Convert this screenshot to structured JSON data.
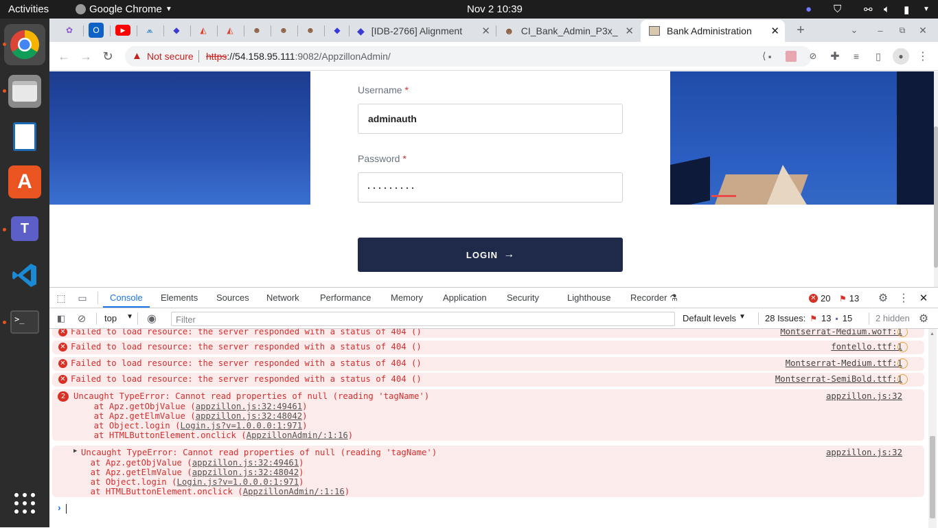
{
  "system": {
    "activities": "Activities",
    "app_menu": "Google Chrome",
    "clock": "Nov 2  10:39"
  },
  "tabs": {
    "tab1_title": "[IDB-2766] Alignment",
    "tab2_title": "CI_Bank_Admin_P3x_",
    "active_title": "Bank Administration"
  },
  "address": {
    "security": "Not secure",
    "scheme": "https",
    "host_url": "://54.158.95.111",
    "port_path": ":9082/AppzillonAdmin/"
  },
  "login": {
    "username_label": "Username",
    "username_value": "adminauth",
    "password_label": "Password",
    "password_value": "·········",
    "required_mark": "*",
    "button": "LOGIN"
  },
  "devtools": {
    "tabs": [
      "Console",
      "Elements",
      "Sources",
      "Network",
      "Performance",
      "Memory",
      "Application",
      "Security",
      "Lighthouse",
      "Recorder"
    ],
    "error_count": "20",
    "issue_flag_count": "13",
    "context": "top",
    "filter_placeholder": "Filter",
    "levels": "Default levels",
    "issues_label": "28 Issues:",
    "issues_errors": "13",
    "issues_info": "15",
    "hidden": "2 hidden"
  },
  "console": {
    "messages": [
      {
        "text": "Failed to load resource: the server responded with a status of 404 ()",
        "source": "Montserrat-Medium.woff:1"
      },
      {
        "text": "Failed to load resource: the server responded with a status of 404 ()",
        "source": "fontello.ttf:1"
      },
      {
        "text": "Failed to load resource: the server responded with a status of 404 ()",
        "source": "Montserrat-Medium.ttf:1"
      },
      {
        "text": "Failed to load resource: the server responded with a status of 404 ()",
        "source": "Montserrat-SemiBold.ttf:1"
      }
    ],
    "error1": {
      "count": "2",
      "text": "Uncaught TypeError: Cannot read properties of null (reading 'tagName')",
      "source": "appzillon.js:32",
      "stack": [
        {
          "pre": "    at Apz.getObjValue (",
          "link": "appzillon.js:32:49461",
          "post": ")"
        },
        {
          "pre": "    at Apz.getElmValue (",
          "link": "appzillon.js:32:48042",
          "post": ")"
        },
        {
          "pre": "    at Object.login (",
          "link": "Login.js?v=1.0.0.0:1:971",
          "post": ")"
        },
        {
          "pre": "    at HTMLButtonElement.onclick (",
          "link": "AppzillonAdmin/:1:16",
          "post": ")"
        }
      ]
    },
    "error2": {
      "text": "Uncaught TypeError: Cannot read properties of null (reading 'tagName')",
      "source": "appzillon.js:32",
      "stack": [
        {
          "pre": "    at Apz.getObjValue (",
          "link": "appzillon.js:32:49461",
          "post": ")"
        },
        {
          "pre": "    at Apz.getElmValue (",
          "link": "appzillon.js:32:48042",
          "post": ")"
        },
        {
          "pre": "    at Object.login (",
          "link": "Login.js?v=1.0.0.0:1:971",
          "post": ")"
        },
        {
          "pre": "    at HTMLButtonElement.onclick (",
          "link": "AppzillonAdmin/:1:16",
          "post": ")"
        }
      ]
    },
    "prompt": "›"
  },
  "colors": {
    "login_button": "#1f2a4a",
    "error_red": "#d93025",
    "error_bg": "#fcebeb",
    "ubuntu_orange": "#e95420"
  }
}
